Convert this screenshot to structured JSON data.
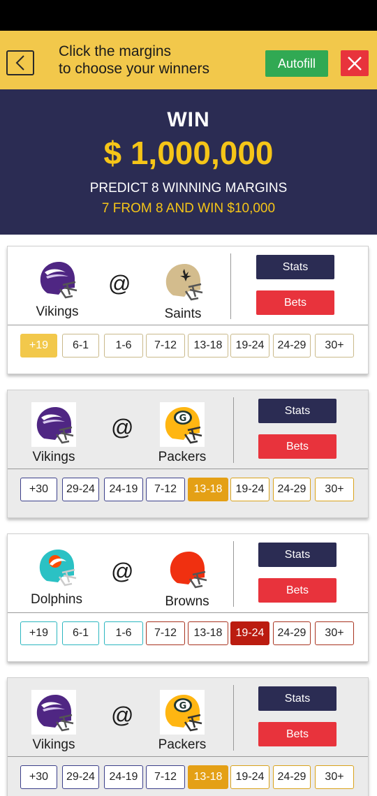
{
  "header": {
    "instruction_line1": "Click the margins",
    "instruction_line2": "to choose your winners",
    "autofill_label": "Autofill"
  },
  "promo": {
    "win": "WIN",
    "amount": "$ 1,000,000",
    "predict": "PREDICT 8 WINNING MARGINS",
    "consolation": "7 FROM 8 AND WIN $10,000"
  },
  "colors": {
    "header_bg": "#f2c84b",
    "navy": "#2b2c53",
    "gold": "#f5c518",
    "green": "#31a953",
    "red": "#e8333c",
    "margin_selected_gold": "#f2c84b",
    "margin_selected_orange": "#e4a016",
    "margin_selected_darkred": "#bb1c10"
  },
  "games": [
    {
      "away": {
        "name": "Vikings",
        "icon": "vikings-helmet-icon"
      },
      "home": {
        "name": "Saints",
        "icon": "saints-helmet-icon"
      },
      "at": "@",
      "stats_label": "Stats",
      "bets_label": "Bets",
      "margins": [
        "+19",
        "6-1",
        "1-6",
        "7-12",
        "13-18",
        "19-24",
        "24-29",
        "30+"
      ],
      "selected_index": 0
    },
    {
      "away": {
        "name": "Vikings",
        "icon": "vikings-helmet-icon"
      },
      "home": {
        "name": "Packers",
        "icon": "packers-helmet-icon"
      },
      "at": "@",
      "stats_label": "Stats",
      "bets_label": "Bets",
      "margins": [
        "+30",
        "29-24",
        "24-19",
        "7-12",
        "13-18",
        "19-24",
        "24-29",
        "30+"
      ],
      "selected_index": 4
    },
    {
      "away": {
        "name": "Dolphins",
        "icon": "dolphins-helmet-icon"
      },
      "home": {
        "name": "Browns",
        "icon": "browns-helmet-icon"
      },
      "at": "@",
      "stats_label": "Stats",
      "bets_label": "Bets",
      "margins": [
        "+19",
        "6-1",
        "1-6",
        "7-12",
        "13-18",
        "19-24",
        "24-29",
        "30+"
      ],
      "selected_index": 5
    },
    {
      "away": {
        "name": "Vikings",
        "icon": "vikings-helmet-icon"
      },
      "home": {
        "name": "Packers",
        "icon": "packers-helmet-icon"
      },
      "at": "@",
      "stats_label": "Stats",
      "bets_label": "Bets",
      "margins": [
        "+30",
        "29-24",
        "24-19",
        "7-12",
        "13-18",
        "19-24",
        "24-29",
        "30+"
      ],
      "selected_index": 4
    }
  ]
}
